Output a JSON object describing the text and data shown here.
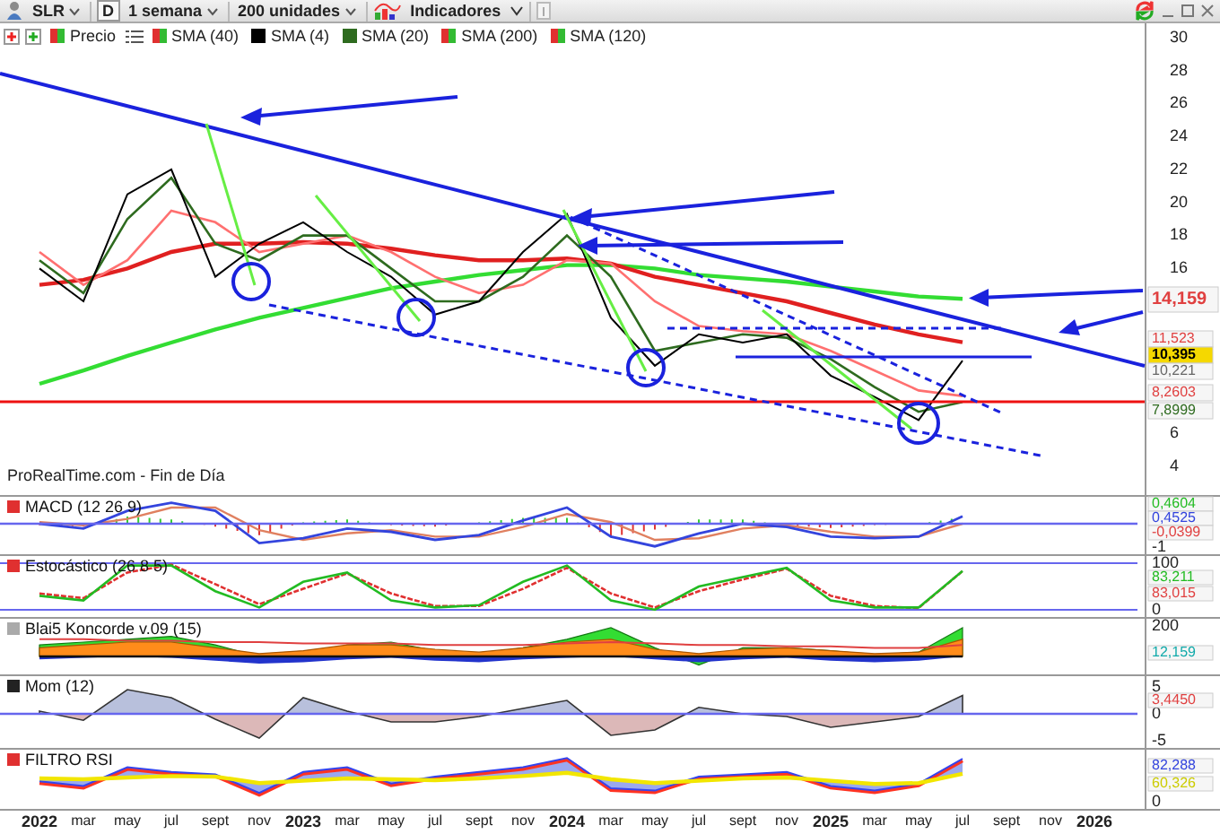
{
  "toolbar": {
    "symbol": "SLR",
    "period_button": "D",
    "timeframe": "1 semana",
    "units": "200 unidades",
    "indicators_label": "Indicadores"
  },
  "legend": [
    {
      "label": "Precio",
      "kind": "updown"
    },
    {
      "label": "SMA (40)",
      "kind": "updown"
    },
    {
      "label": "SMA (4)",
      "kind": "solid",
      "color": "#000000"
    },
    {
      "label": "SMA (20)",
      "kind": "solid",
      "color": "#2e6b1f"
    },
    {
      "label": "SMA (200)",
      "kind": "updown"
    },
    {
      "label": "SMA (120)",
      "kind": "updown"
    }
  ],
  "main_chart": {
    "source_label": "ProRealTime.com - Fin de Día",
    "axis_labels": [
      "30",
      "28",
      "26",
      "24",
      "22",
      "20",
      "18",
      "16",
      "6",
      "4"
    ],
    "readings": [
      {
        "text": "14,159",
        "color": "#e04040",
        "kind": "large"
      },
      {
        "text": "11,523",
        "color": "#e04040",
        "kind": "normal"
      },
      {
        "text": "10,395",
        "kind": "current"
      },
      {
        "text": "10,221",
        "color": "#666666",
        "kind": "normal"
      },
      {
        "text": "8,2603",
        "color": "#e04040",
        "kind": "normal"
      },
      {
        "text": "7,8999",
        "color": "#2e6b1f",
        "kind": "normal"
      }
    ]
  },
  "panels": [
    {
      "kind": "macd",
      "title": "MACD (12 26 9)",
      "axis_labels": [
        "-1"
      ],
      "readings": [
        {
          "text": "0,4604",
          "color": "#22bb22"
        },
        {
          "text": "0,4525",
          "color": "#3344dd"
        },
        {
          "text": "-0,0399",
          "color": "#e04040"
        }
      ]
    },
    {
      "kind": "stochastic",
      "title": "Estocástico (26 8 5)",
      "axis_labels": [
        "100",
        "0"
      ],
      "readings": [
        {
          "text": "83,211",
          "color": "#22bb22"
        },
        {
          "text": "83,015",
          "color": "#e04040"
        }
      ]
    },
    {
      "kind": "koncorde",
      "title": "Blai5 Koncorde v.09 (15)",
      "axis_labels": [
        "200"
      ],
      "readings": [
        {
          "text": "12,159",
          "color": "#11aaaa"
        }
      ]
    },
    {
      "kind": "momentum",
      "title": "Mom (12)",
      "axis_labels": [
        "5",
        "0",
        "-5"
      ],
      "readings": [
        {
          "text": "3,4450",
          "color": "#e04040"
        }
      ]
    },
    {
      "kind": "rsi",
      "title": "FILTRO RSI",
      "axis_labels": [
        "0"
      ],
      "readings": [
        {
          "text": "82,288",
          "color": "#3344dd"
        },
        {
          "text": "60,326",
          "color": "#cccc00"
        }
      ]
    }
  ],
  "x_axis": [
    {
      "label": "2022",
      "kind": "year"
    },
    {
      "label": "mar",
      "kind": "month"
    },
    {
      "label": "may",
      "kind": "month"
    },
    {
      "label": "jul",
      "kind": "month"
    },
    {
      "label": "sept",
      "kind": "month"
    },
    {
      "label": "nov",
      "kind": "month"
    },
    {
      "label": "2023",
      "kind": "year"
    },
    {
      "label": "mar",
      "kind": "month"
    },
    {
      "label": "may",
      "kind": "month"
    },
    {
      "label": "jul",
      "kind": "month"
    },
    {
      "label": "sept",
      "kind": "month"
    },
    {
      "label": "nov",
      "kind": "month"
    },
    {
      "label": "2024",
      "kind": "year"
    },
    {
      "label": "mar",
      "kind": "month"
    },
    {
      "label": "may",
      "kind": "month"
    },
    {
      "label": "jul",
      "kind": "month"
    },
    {
      "label": "sept",
      "kind": "month"
    },
    {
      "label": "nov",
      "kind": "month"
    },
    {
      "label": "2025",
      "kind": "year"
    },
    {
      "label": "mar",
      "kind": "month"
    },
    {
      "label": "may",
      "kind": "month"
    },
    {
      "label": "jul",
      "kind": "month"
    },
    {
      "label": "sept",
      "kind": "month"
    },
    {
      "label": "nov",
      "kind": "month"
    },
    {
      "label": "2026",
      "kind": "year"
    }
  ]
}
